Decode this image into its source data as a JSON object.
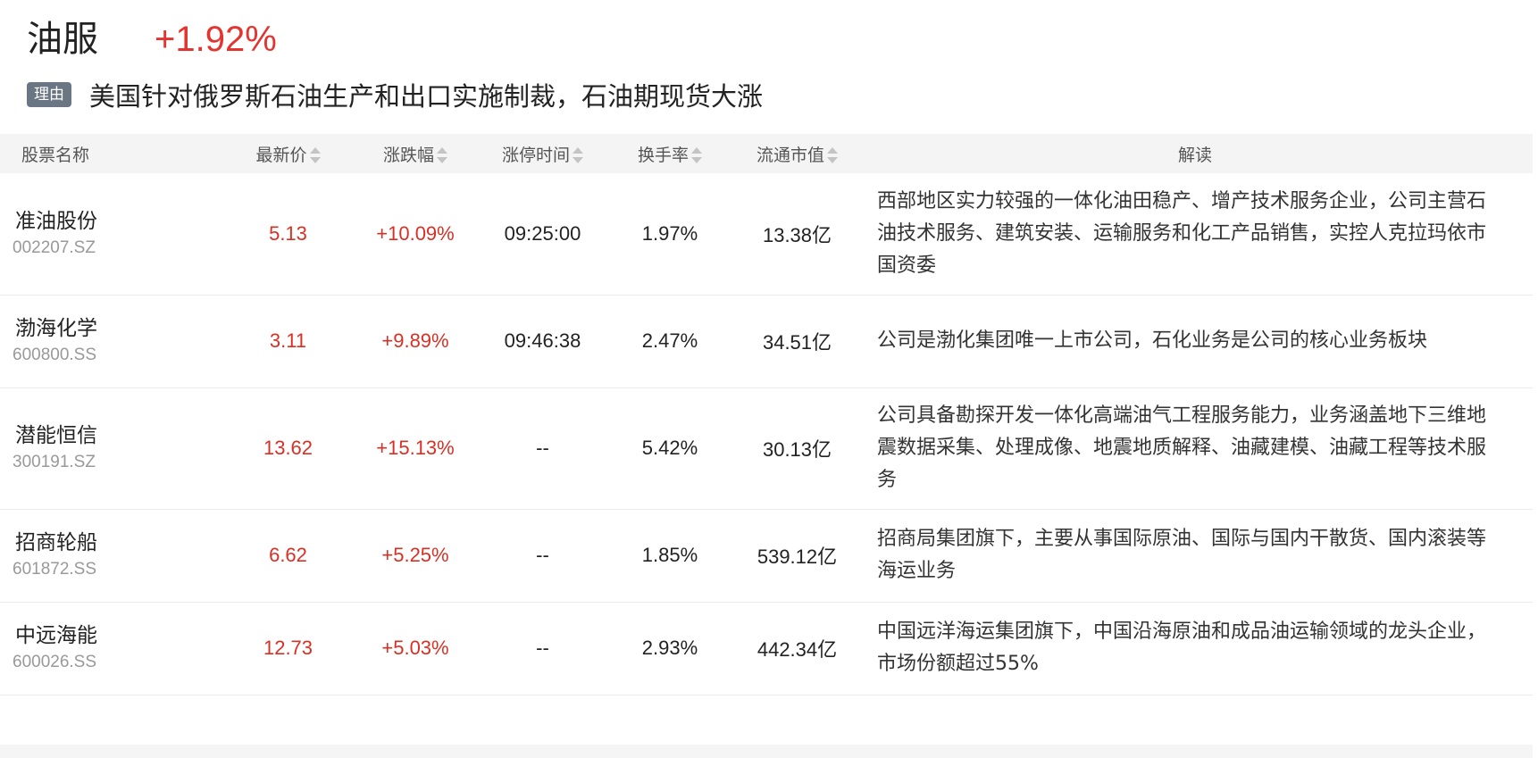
{
  "sector": {
    "name": "油服",
    "change": "+1.92%",
    "reason_tag": "理由",
    "reason_text": "美国针对俄罗斯石油生产和出口实施制裁，石油期现货大涨"
  },
  "table": {
    "headers": {
      "name": "股票名称",
      "price": "最新价",
      "change": "涨跌幅",
      "limit_time": "涨停时间",
      "turnover": "换手率",
      "market_cap": "流通市值",
      "desc": "解读"
    },
    "rows": [
      {
        "name": "准油股份",
        "code": "002207.SZ",
        "price": "5.13",
        "change": "+10.09%",
        "limit_time": "09:25:00",
        "turnover": "1.97%",
        "market_cap": "13.38亿",
        "desc": "西部地区实力较强的一体化油田稳产、增产技术服务企业，公司主营石油技术服务、建筑安装、运输服务和化工产品销售，实控人克拉玛依市国资委"
      },
      {
        "name": "渤海化学",
        "code": "600800.SS",
        "price": "3.11",
        "change": "+9.89%",
        "limit_time": "09:46:38",
        "turnover": "2.47%",
        "market_cap": "34.51亿",
        "desc": "公司是渤化集团唯一上市公司，石化业务是公司的核心业务板块"
      },
      {
        "name": "潜能恒信",
        "code": "300191.SZ",
        "price": "13.62",
        "change": "+15.13%",
        "limit_time": "--",
        "turnover": "5.42%",
        "market_cap": "30.13亿",
        "desc": "公司具备勘探开发一体化高端油气工程服务能力，业务涵盖地下三维地震数据采集、处理成像、地震地质解释、油藏建模、油藏工程等技术服务"
      },
      {
        "name": "招商轮船",
        "code": "601872.SS",
        "price": "6.62",
        "change": "+5.25%",
        "limit_time": "--",
        "turnover": "1.85%",
        "market_cap": "539.12亿",
        "desc": "招商局集团旗下，主要从事国际原油、国际与国内干散货、国内滚装等海运业务"
      },
      {
        "name": "中远海能",
        "code": "600026.SS",
        "price": "12.73",
        "change": "+5.03%",
        "limit_time": "--",
        "turnover": "2.93%",
        "market_cap": "442.34亿",
        "desc": "中国远洋海运集团旗下，中国沿海原油和成品油运输领域的龙头企业，市场份额超过55%"
      }
    ]
  }
}
